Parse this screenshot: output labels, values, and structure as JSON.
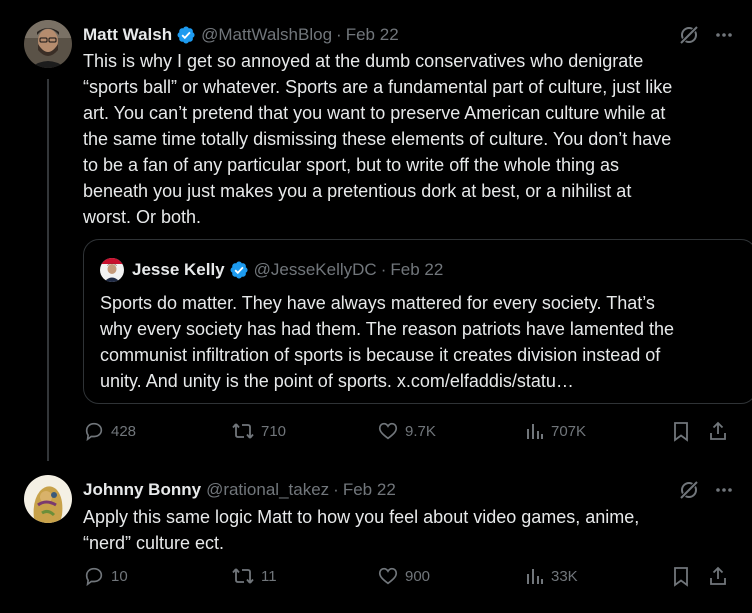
{
  "posts": [
    {
      "name": "Matt Walsh",
      "handle": "@MattWalshBlog",
      "dot": "·",
      "date": "Feb 22",
      "text_lines": [
        "This is why I get so annoyed at the dumb conservatives who denigrate",
        "“sports ball” or whatever. Sports are a fundamental part of culture, just like",
        "art. You can’t pretend that you want to preserve American culture while at",
        "the same time totally dismissing these elements of culture. You don’t have",
        "to be a fan of any particular sport, but to write off the whole thing as",
        "beneath you just makes you a pretentious dork at best, or a nihilist at",
        "worst. Or both."
      ],
      "quote": {
        "name": "Jesse Kelly",
        "handle": "@JesseKellyDC",
        "dot": "·",
        "date": "Feb 22",
        "text_lines": [
          "Sports do matter. They have always mattered for every society. That’s",
          "why every society has had them. The reason patriots have lamented the",
          "communist infiltration of sports is because it creates division instead of",
          "unity. And unity is the point of sports. x.com/elfaddis/statu…"
        ]
      },
      "stats": {
        "replies": "428",
        "reposts": "710",
        "likes": "9.7K",
        "views": "707K"
      }
    },
    {
      "name": "Johnny Bonny",
      "handle": "@rational_takez",
      "dot": "·",
      "date": "Feb 22",
      "text_lines": [
        "Apply this same logic Matt to how you feel about video games, anime,",
        "“nerd” culture ect."
      ],
      "stats": {
        "replies": "10",
        "reposts": "11",
        "likes": "900",
        "views": "33K"
      }
    }
  ],
  "colors": {
    "text": "#e7e9ea",
    "muted": "#71767b",
    "verified": "#1d9bf0",
    "border": "#2f3336"
  },
  "icons": [
    "verified-badge-icon",
    "grok-icon",
    "more-icon",
    "reply-icon",
    "repost-icon",
    "like-icon",
    "views-icon",
    "bookmark-icon",
    "share-icon"
  ]
}
